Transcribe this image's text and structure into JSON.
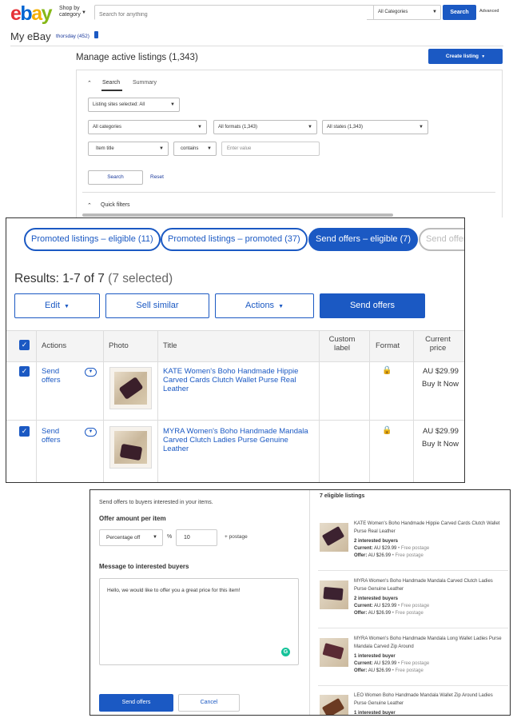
{
  "header": {
    "logo_letters": [
      "e",
      "b",
      "a",
      "y"
    ],
    "logo_colors": [
      "#e53238",
      "#0064d2",
      "#f5af02",
      "#86b817"
    ],
    "shop_by_category": "Shop by category",
    "search_placeholder": "Search for anything",
    "category_select": "All Categories",
    "search_button": "Search",
    "advanced_link": "Advanced"
  },
  "myebay": {
    "title": "My eBay",
    "username": "thorsday (452)"
  },
  "manage": {
    "title": "Manage active listings (1,343)",
    "create_listing": "Create listing",
    "tabs": [
      "Search",
      "Summary"
    ],
    "listing_sites": "Listing sites selected: All",
    "categories": "All categories",
    "formats": "All formats (1,343)",
    "states": "All states (1,343)",
    "field": "Item title",
    "operator": "contains",
    "value_placeholder": "Enter value",
    "search_button": "Search",
    "reset_link": "Reset",
    "quick_filters": "Quick filters"
  },
  "results_panel": {
    "pills": [
      "Promoted listings – eligible (11)",
      "Promoted listings – promoted (37)",
      "Send offers – eligible (7)",
      "Send offers"
    ],
    "results_text": "Results: 1-7 of 7",
    "selected_text": "(7 selected)",
    "buttons": {
      "edit": "Edit",
      "sell_similar": "Sell similar",
      "actions": "Actions",
      "send_offers": "Send offers"
    },
    "columns": {
      "actions": "Actions",
      "photo": "Photo",
      "title": "Title",
      "custom_label": "Custom label",
      "format": "Format",
      "current_price": "Current price"
    },
    "rows": [
      {
        "action": "Send offers",
        "title": "KATE Women's Boho Handmade Hippie Carved Cards Clutch Wallet Purse Real Leather",
        "price": "AU $29.99",
        "format": "Buy It Now"
      },
      {
        "action": "Send offers",
        "title": "MYRA Women's Boho Handmade Mandala Carved Clutch Ladies Purse Genuine Leather",
        "price": "AU $29.99",
        "format": "Buy It Now"
      }
    ]
  },
  "offer_panel": {
    "intro": "Send offers to buyers interested in your items.",
    "amount_heading": "Offer amount per item",
    "discount_type": "Percentage off",
    "percent_sign": "%",
    "amount_value": "10",
    "postage_text": "+ postage",
    "message_heading": "Message to interested buyers",
    "message": "Hello, we would like to offer you a great price for this item!",
    "grammarly": "G",
    "send_button": "Send offers",
    "cancel_button": "Cancel",
    "eligible_heading": "7 eligible listings",
    "items": [
      {
        "title": "KATE Women's Boho Handmade Hippie Carved Cards Clutch Wallet Purse Real Leather",
        "buyers": "2 interested buyers",
        "current_label": "Current:",
        "current": "AU $29.99",
        "offer_label": "Offer:",
        "offer": "AU $26.99",
        "postage": "• Free postage"
      },
      {
        "title": "MYRA Women's Boho Handmade Mandala Carved Clutch Ladies Purse Genuine Leather",
        "buyers": "2 interested buyers",
        "current_label": "Current:",
        "current": "AU $29.99",
        "offer_label": "Offer:",
        "offer": "AU $26.99",
        "postage": "• Free postage"
      },
      {
        "title": "MYRA Women's Boho Handmade Mandala Long Wallet Ladies Purse Mandala Carved Zip Around",
        "buyers": "1 interested buyer",
        "current_label": "Current:",
        "current": "AU $29.99",
        "offer_label": "Offer:",
        "offer": "AU $26.99",
        "postage": "• Free postage"
      },
      {
        "title": "LEO Women Boho Handmade Mandala Wallet Zip Around Ladies Purse Genuine Leather",
        "buyers": "1 interested buyer"
      }
    ]
  }
}
